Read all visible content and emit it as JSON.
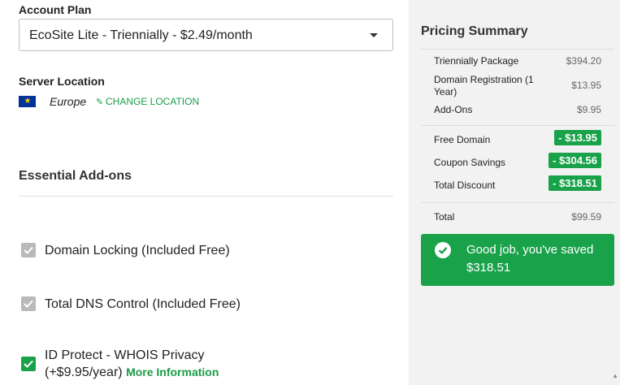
{
  "account_plan": {
    "label": "Account Plan",
    "selected": "EcoSite Lite - Triennially - $2.49/month"
  },
  "server_location": {
    "label": "Server Location",
    "region": "Europe",
    "change_label": "CHANGE LOCATION"
  },
  "addons": {
    "title": "Essential Add-ons",
    "items": [
      {
        "label": "Domain Locking (Included Free)",
        "checked": true,
        "disabled": true
      },
      {
        "label": "Total DNS Control (Included Free)",
        "checked": true,
        "disabled": true
      },
      {
        "label_line1": "ID Protect - WHOIS Privacy",
        "label_line2": "(+$9.95/year)",
        "link": "More Information",
        "checked": true,
        "disabled": false
      }
    ]
  },
  "pricing": {
    "title": "Pricing Summary",
    "rows": [
      {
        "name": "Triennially Package",
        "amount": "$394.20"
      },
      {
        "name": "Domain Registration (1 Year)",
        "amount": "$13.95"
      },
      {
        "name": "Add-Ons",
        "amount": "$9.95"
      }
    ],
    "discounts": [
      {
        "name": "Free Domain",
        "amount": "- $13.95"
      },
      {
        "name": "Coupon Savings",
        "amount": "- $304.56"
      },
      {
        "name": "Total Discount",
        "amount": "- $318.51"
      }
    ],
    "total": {
      "name": "Total",
      "amount": "$99.59"
    },
    "saved_message": "Good job, you've saved $318.51"
  },
  "colors": {
    "accent": "#1aa24a",
    "checkbox_disabled": "#b9b9b9",
    "panel_bg": "#f2f2f2"
  },
  "icons": [
    "caret-down-icon",
    "eu-flag-icon",
    "pencil-icon",
    "checkbox-icon",
    "check-circle-icon"
  ]
}
